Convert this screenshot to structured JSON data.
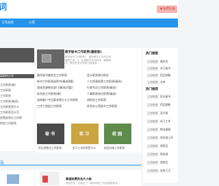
{
  "header": {
    "logo_text": "词",
    "register_label": "免费注册"
  },
  "nav": {
    "items": [
      "工作总结",
      "心得"
    ]
  },
  "left_menu": {
    "items": [
      "离职的工作",
      "工作职责(精)",
      "工作职责",
      "工作职责",
      "工作职责(精选)",
      "工作职责是什么",
      "工作职责怎么写",
      "经营部岗位工作职",
      "财务工作职责"
    ]
  },
  "feature": {
    "title": "教学秘书工作职责(最新版)",
    "desc": "教学秘书工作职责1、做好教学工作的日常管理工作。2、负责教学计划安排、课表编排、教学任务安排等日常事务..."
  },
  "links": {
    "rows": [
      [
        "委托秘书美发总工作职责",
        "会计职责岗位职业"
      ],
      [
        "秘书工作职责说明书(精选8篇)",
        "人力资源经营工作职责(精选)"
      ],
      [
        "固体资源物业部门(精选16篇)",
        "行政专员工作职责(精选)"
      ],
      [
        "综合部工作职责(精)",
        "人事职责岗位职责(精选)"
      ],
      [
        "电商客户专员要求是什么工作职责",
        "质检员工作职责"
      ],
      [
        "工作工程部工作职责",
        "综合办公室秘书工作职责"
      ]
    ]
  },
  "photos": {
    "items": [
      {
        "label": "秘 书",
        "caption": "药品销售员工作职责"
      },
      {
        "label": "实 习",
        "caption": "实习工作职责是什么"
      },
      {
        "label": "校 园",
        "caption": "校园内纳工作职责"
      }
    ]
  },
  "hot_search": {
    "heading": "热门搜索",
    "items": [
      {
        "tag": "工作职责",
        "text": "操作员"
      },
      {
        "tag": "工作职责",
        "text": "关于秘书"
      },
      {
        "tag": "工作职责",
        "text": "药品销售"
      },
      {
        "tag": "工作职责",
        "text": "仓库"
      }
    ]
  },
  "hot_recommend": {
    "heading": "热门推荐",
    "items": [
      {
        "tag": "工作职责",
        "text": "区长秘书"
      },
      {
        "tag": "工作职责",
        "text": "药品销售"
      },
      {
        "tag": "工作职责",
        "text": "设计部"
      },
      {
        "tag": "工作职责",
        "text": "实习工作"
      },
      {
        "tag": "工作职责",
        "text": "物业客服"
      },
      {
        "tag": "工作职责",
        "text": "综合部工作"
      },
      {
        "tag": "工作职责",
        "text": "质检员"
      },
      {
        "tag": "工作职责",
        "text": "财务部"
      },
      {
        "tag": "工作职责",
        "text": "保育员"
      },
      {
        "tag": "工作职责",
        "text": "金库门卫"
      }
    ]
  },
  "section": {
    "label": "告"
  },
  "bottom": {
    "title": "高速收费员名片小结",
    "desc": "收费员员，在经过了一段时间的工作后感受很深..."
  }
}
